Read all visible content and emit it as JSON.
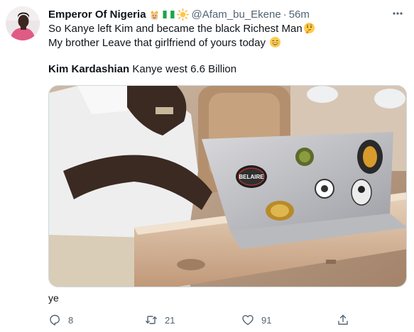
{
  "tweet": {
    "author_name": "Emperor Of Nigeria",
    "handle": "@Afam_bu_Ekene",
    "separator": "·",
    "time": "56m",
    "text_line_1": "So Kanye left Kim and became the black Richest Man",
    "text_line_2": "My brother Leave that girlfriend of yours today",
    "caption_bold": "Kim Kardashian",
    "caption_rest": " Kanye west  6.6 Billion",
    "laptop_sticker_text": "BELAIRE",
    "footer_text": "ye",
    "actions": {
      "reply_count": "8",
      "retweet_count": "21",
      "like_count": "91"
    },
    "colors": {
      "text": "#0f1419",
      "secondary": "#536471",
      "border": "#cfd9de"
    },
    "icons": [
      "more-icon",
      "reply-icon",
      "retweet-icon",
      "like-icon",
      "share-icon",
      "king-emoji-icon",
      "nigeria-flag-icon",
      "sun-emoji-icon",
      "thinking-emoji-icon",
      "grinning-emoji-icon"
    ]
  }
}
